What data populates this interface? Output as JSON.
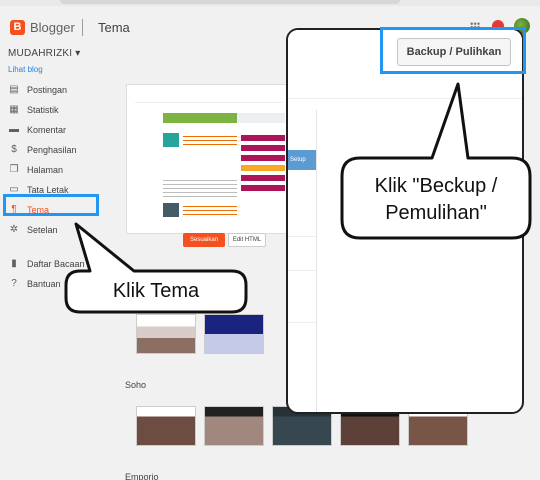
{
  "header": {
    "logo_letter": "B",
    "app_name": "Blogger",
    "page_title": "Tema"
  },
  "sidebar": {
    "blog_name": "MUDAHRIZKI ▾",
    "view_blog": "Lihat blog",
    "items": [
      {
        "label": "Postingan",
        "icon": "posts-icon"
      },
      {
        "label": "Statistik",
        "icon": "stats-icon"
      },
      {
        "label": "Komentar",
        "icon": "comments-icon"
      },
      {
        "label": "Penghasilan",
        "icon": "earnings-icon"
      },
      {
        "label": "Halaman",
        "icon": "pages-icon"
      },
      {
        "label": "Tata Letak",
        "icon": "layout-icon"
      },
      {
        "label": "Tema",
        "icon": "theme-icon",
        "active": true
      },
      {
        "label": "Setelan",
        "icon": "settings-icon"
      },
      {
        "label": "Daftar Bacaan",
        "icon": "reading-list-icon"
      },
      {
        "label": "Bantuan",
        "icon": "help-icon"
      }
    ]
  },
  "main": {
    "customize_label": "Sesuaikan",
    "edit_html_label": "Edit HTML",
    "groups": [
      "Soho",
      "Emporio"
    ]
  },
  "popup": {
    "backup_label": "Backup / Pulihkan",
    "edge_label": "Setup"
  },
  "annotations": {
    "tema_callout": "Klik Tema",
    "backup_callout_line1": "Klik \"Beckup /",
    "backup_callout_line2": "Pemulihan\""
  },
  "colors": {
    "accent": "#f4511e",
    "highlight": "#2196f3",
    "link": "#1e88e5"
  }
}
